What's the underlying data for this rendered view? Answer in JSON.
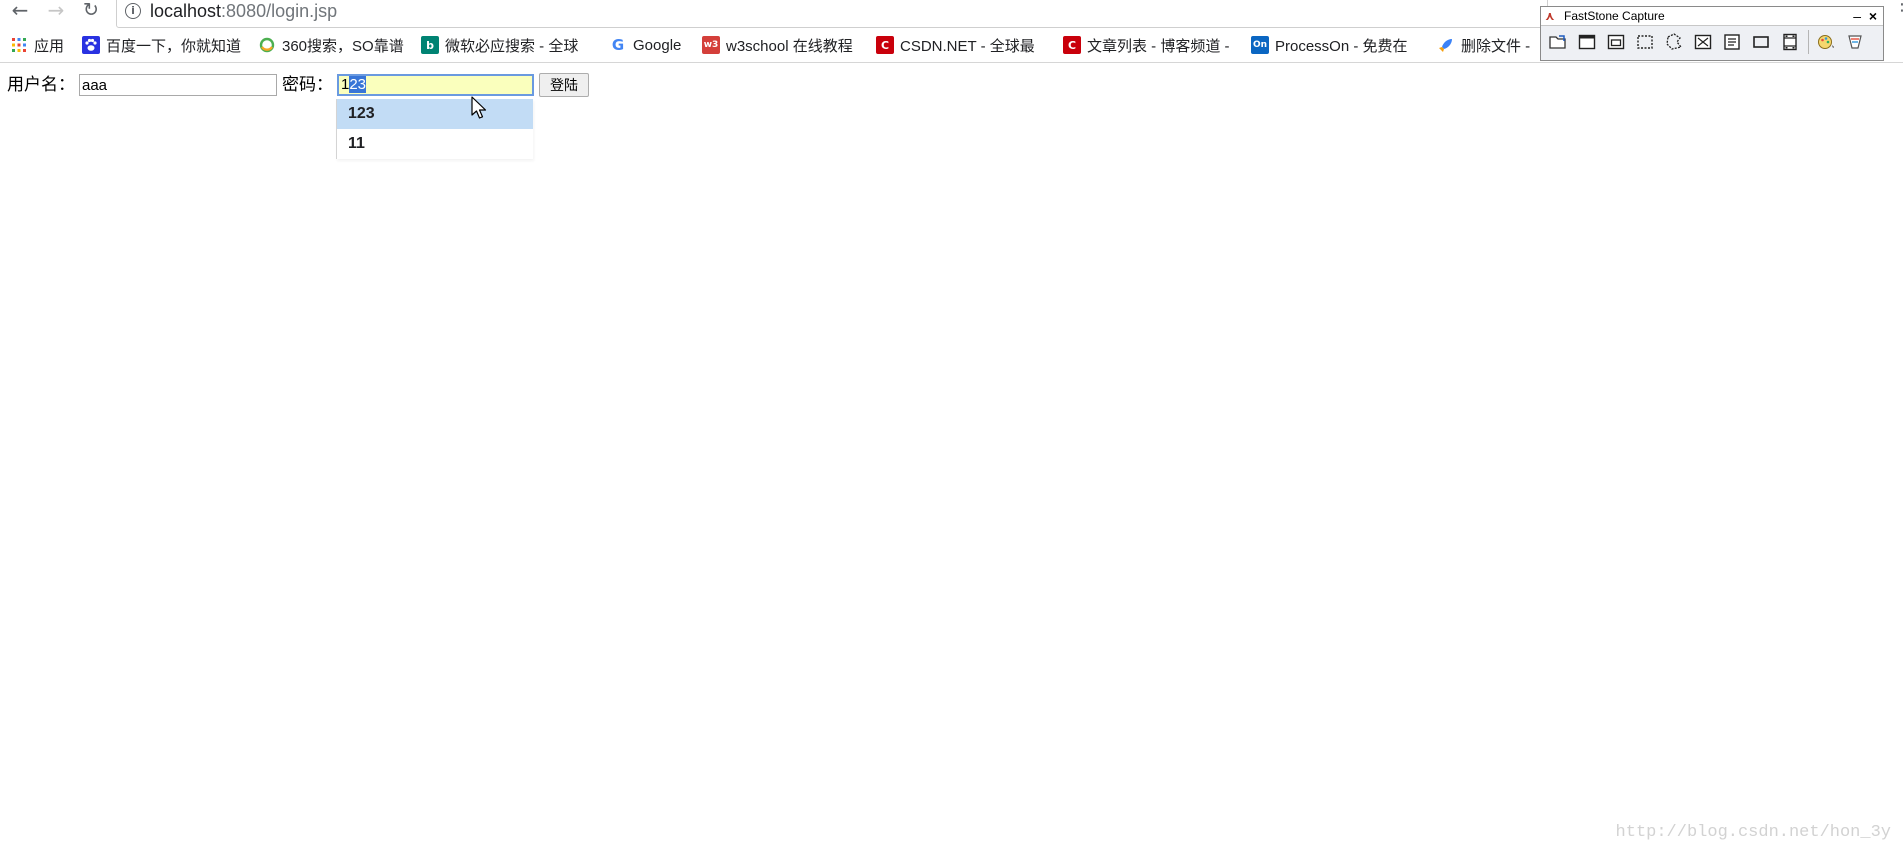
{
  "browser": {
    "url_host": "localhost",
    "url_rest": ":8080/login.jsp",
    "bookmarks": [
      {
        "icon": "apps-grid-icon",
        "label": "应用"
      },
      {
        "icon": "baidu-paw-icon",
        "label": "百度一下，你就知道",
        "color": "#2932e1"
      },
      {
        "icon": "360-icon",
        "label": "360搜索，SO靠谱",
        "color": "#f5a623"
      },
      {
        "icon": "bing-icon",
        "label": "微软必应搜索 - 全球",
        "color": "#008373"
      },
      {
        "icon": "google-icon",
        "label": "Google"
      },
      {
        "icon": "w3school-icon",
        "label": "w3school 在线教程",
        "color": "#d43f3a",
        "glyph": "w3"
      },
      {
        "icon": "csdn-icon",
        "label": "CSDN.NET - 全球最",
        "color": "#c9000b",
        "glyph": "C"
      },
      {
        "icon": "csdn-icon",
        "label": "文章列表 - 博客频道 -",
        "color": "#c9000b",
        "glyph": "C"
      },
      {
        "icon": "processon-icon",
        "label": "ProcessOn - 免费在",
        "color": "#0a66c2",
        "glyph": "On"
      },
      {
        "icon": "rocket-icon",
        "label": "删除文件 -"
      }
    ]
  },
  "faststone": {
    "title": "FastStone Capture",
    "min": "–",
    "close": "×",
    "logo": "⋏"
  },
  "form": {
    "username_label": "用户名：",
    "username_value": "aaa",
    "password_label": "密码：",
    "password_typed": "1",
    "password_selected": "23",
    "login_button": "登陆"
  },
  "autocomplete": {
    "items": [
      "123",
      "11"
    ],
    "highlighted_index": 0
  },
  "watermark": "http://blog.csdn.net/hon_3y"
}
